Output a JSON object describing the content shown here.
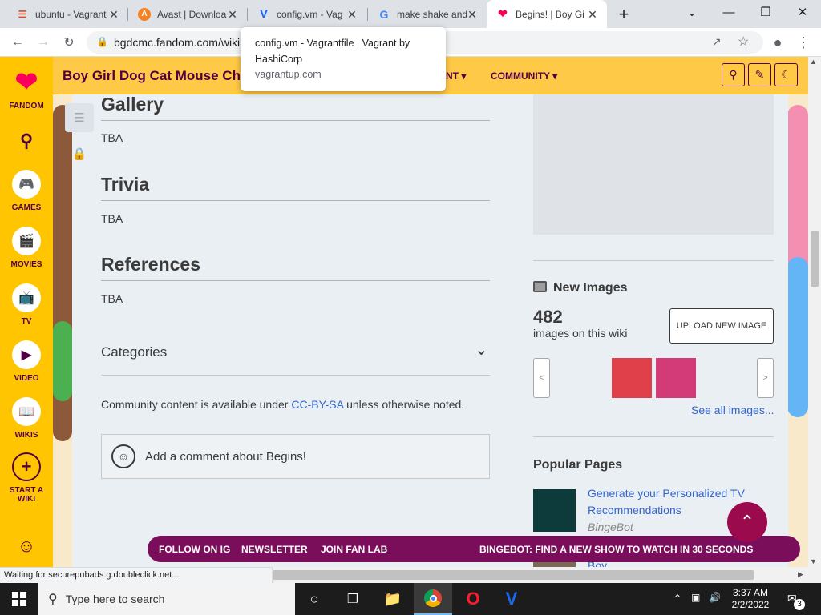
{
  "browser": {
    "tabs": [
      {
        "label": "ubuntu - Vagrant",
        "icon": "ubuntu-icon"
      },
      {
        "label": "Avast | Downloa",
        "icon": "avast-icon"
      },
      {
        "label": "config.vm - Vag",
        "icon": "vagrant-icon"
      },
      {
        "label": "make shake and",
        "icon": "google-icon"
      },
      {
        "label": "Begins! | Boy Gi",
        "icon": "fandom-icon",
        "active": true
      }
    ],
    "url": "bgdcmc.fandom.com/wiki",
    "tooltip": {
      "title": "config.vm - Vagrantfile | Vagrant by HashiCorp",
      "domain": "vagrantup.com"
    }
  },
  "rail": {
    "logo": "FANDOM",
    "items": [
      {
        "label": "GAMES",
        "icon": "games-icon"
      },
      {
        "label": "MOVIES",
        "icon": "movies-icon"
      },
      {
        "label": "TV",
        "icon": "tv-icon"
      },
      {
        "label": "VIDEO",
        "icon": "video-icon"
      },
      {
        "label": "WIKIS",
        "icon": "wikis-icon"
      },
      {
        "label": "START A WIKI",
        "icon": "plus-icon"
      }
    ]
  },
  "wiki": {
    "title": "Boy Girl Dog Cat Mouse Cheese",
    "nav": [
      "NT",
      "COMMUNITY"
    ]
  },
  "article": {
    "sections": [
      {
        "heading": "Gallery",
        "text": "TBA"
      },
      {
        "heading": "Trivia",
        "text": "TBA"
      },
      {
        "heading": "References",
        "text": "TBA"
      }
    ],
    "categories_label": "Categories",
    "license_pre": "Community content is available under ",
    "license_link": "CC-BY-SA",
    "license_post": " unless otherwise noted.",
    "comment_placeholder": "Add a comment about Begins!"
  },
  "sidebar": {
    "new_images": {
      "heading": "New Images",
      "count": "482",
      "count_label": "images on this wiki",
      "upload_label": "UPLOAD NEW IMAGE",
      "see_all": "See all images..."
    },
    "popular_pages": {
      "heading": "Popular Pages",
      "item_title_1": "Generate your Personalized TV",
      "item_title_2": "Recommendations",
      "item_sub": "BingeBot",
      "next_item": "Boy"
    }
  },
  "banner": {
    "items": [
      "FOLLOW ON IG",
      "NEWSLETTER",
      "JOIN FAN LAB"
    ],
    "cta": "BINGEBOT: FIND A NEW SHOW TO WATCH IN 30 SECONDS"
  },
  "status_text": "Waiting for securepubads.g.doubleclick.net...",
  "taskbar": {
    "search_placeholder": "Type here to search",
    "time": "3:37 AM",
    "date": "2/2/2022",
    "notifications": "3"
  },
  "colors": {
    "rail": "#ffc500",
    "brand": "#520044",
    "banner": "#7a0e5a",
    "link": "#3366cc"
  }
}
